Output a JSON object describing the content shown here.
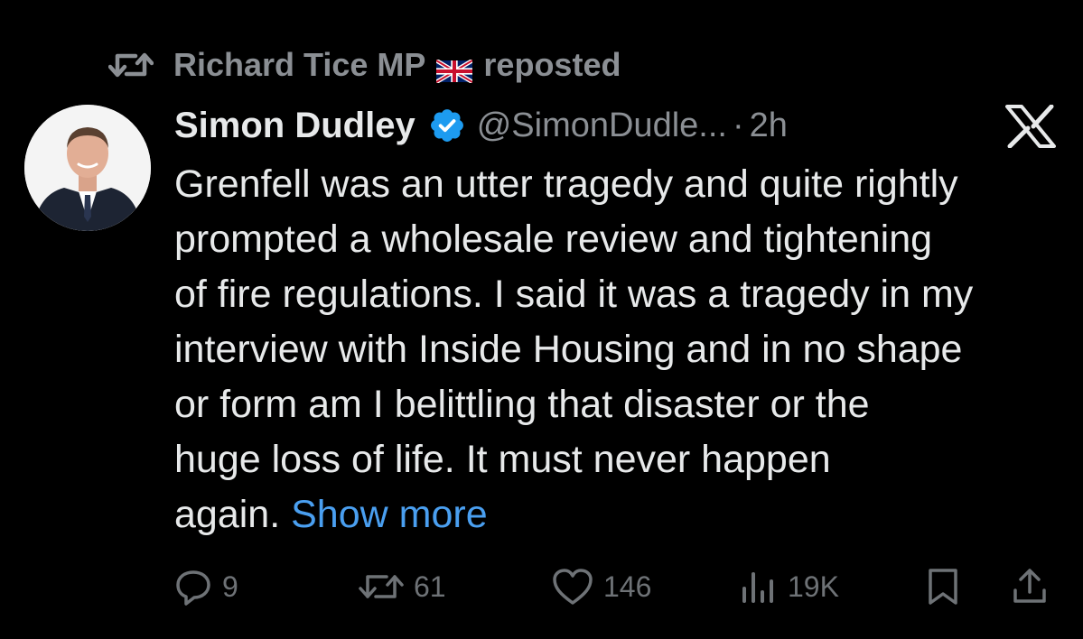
{
  "repost": {
    "reposter": "Richard Tice MP",
    "suffix": "reposted"
  },
  "tweet": {
    "author_name": "Simon Dudley",
    "handle": "@SimonDudle...",
    "separator": "·",
    "time": "2h",
    "body_lines": [
      "Grenfell was an utter tragedy and quite rightly",
      "prompted a wholesale review and tightening",
      "of fire regulations. I said it was a tragedy in my",
      "interview with Inside Housing and in no shape",
      "or form am I belittling that disaster or the",
      "huge loss of life. It must never happen",
      "again."
    ],
    "show_more": "Show more"
  },
  "actions": {
    "replies": "9",
    "reposts": "61",
    "likes": "146",
    "views": "19K"
  },
  "icons": {
    "repost": "repost-icon",
    "flag": "uk-flag-icon",
    "verified": "verified-badge-icon",
    "platform": "x-logo-icon",
    "reply": "reply-icon",
    "like": "heart-icon",
    "views": "views-chart-icon",
    "bookmark": "bookmark-icon",
    "share": "share-icon"
  },
  "colors": {
    "background": "#000000",
    "text": "#e7e9ea",
    "secondary": "#8b8f94",
    "link": "#4a9ff0",
    "verified": "#1d9bf0"
  }
}
